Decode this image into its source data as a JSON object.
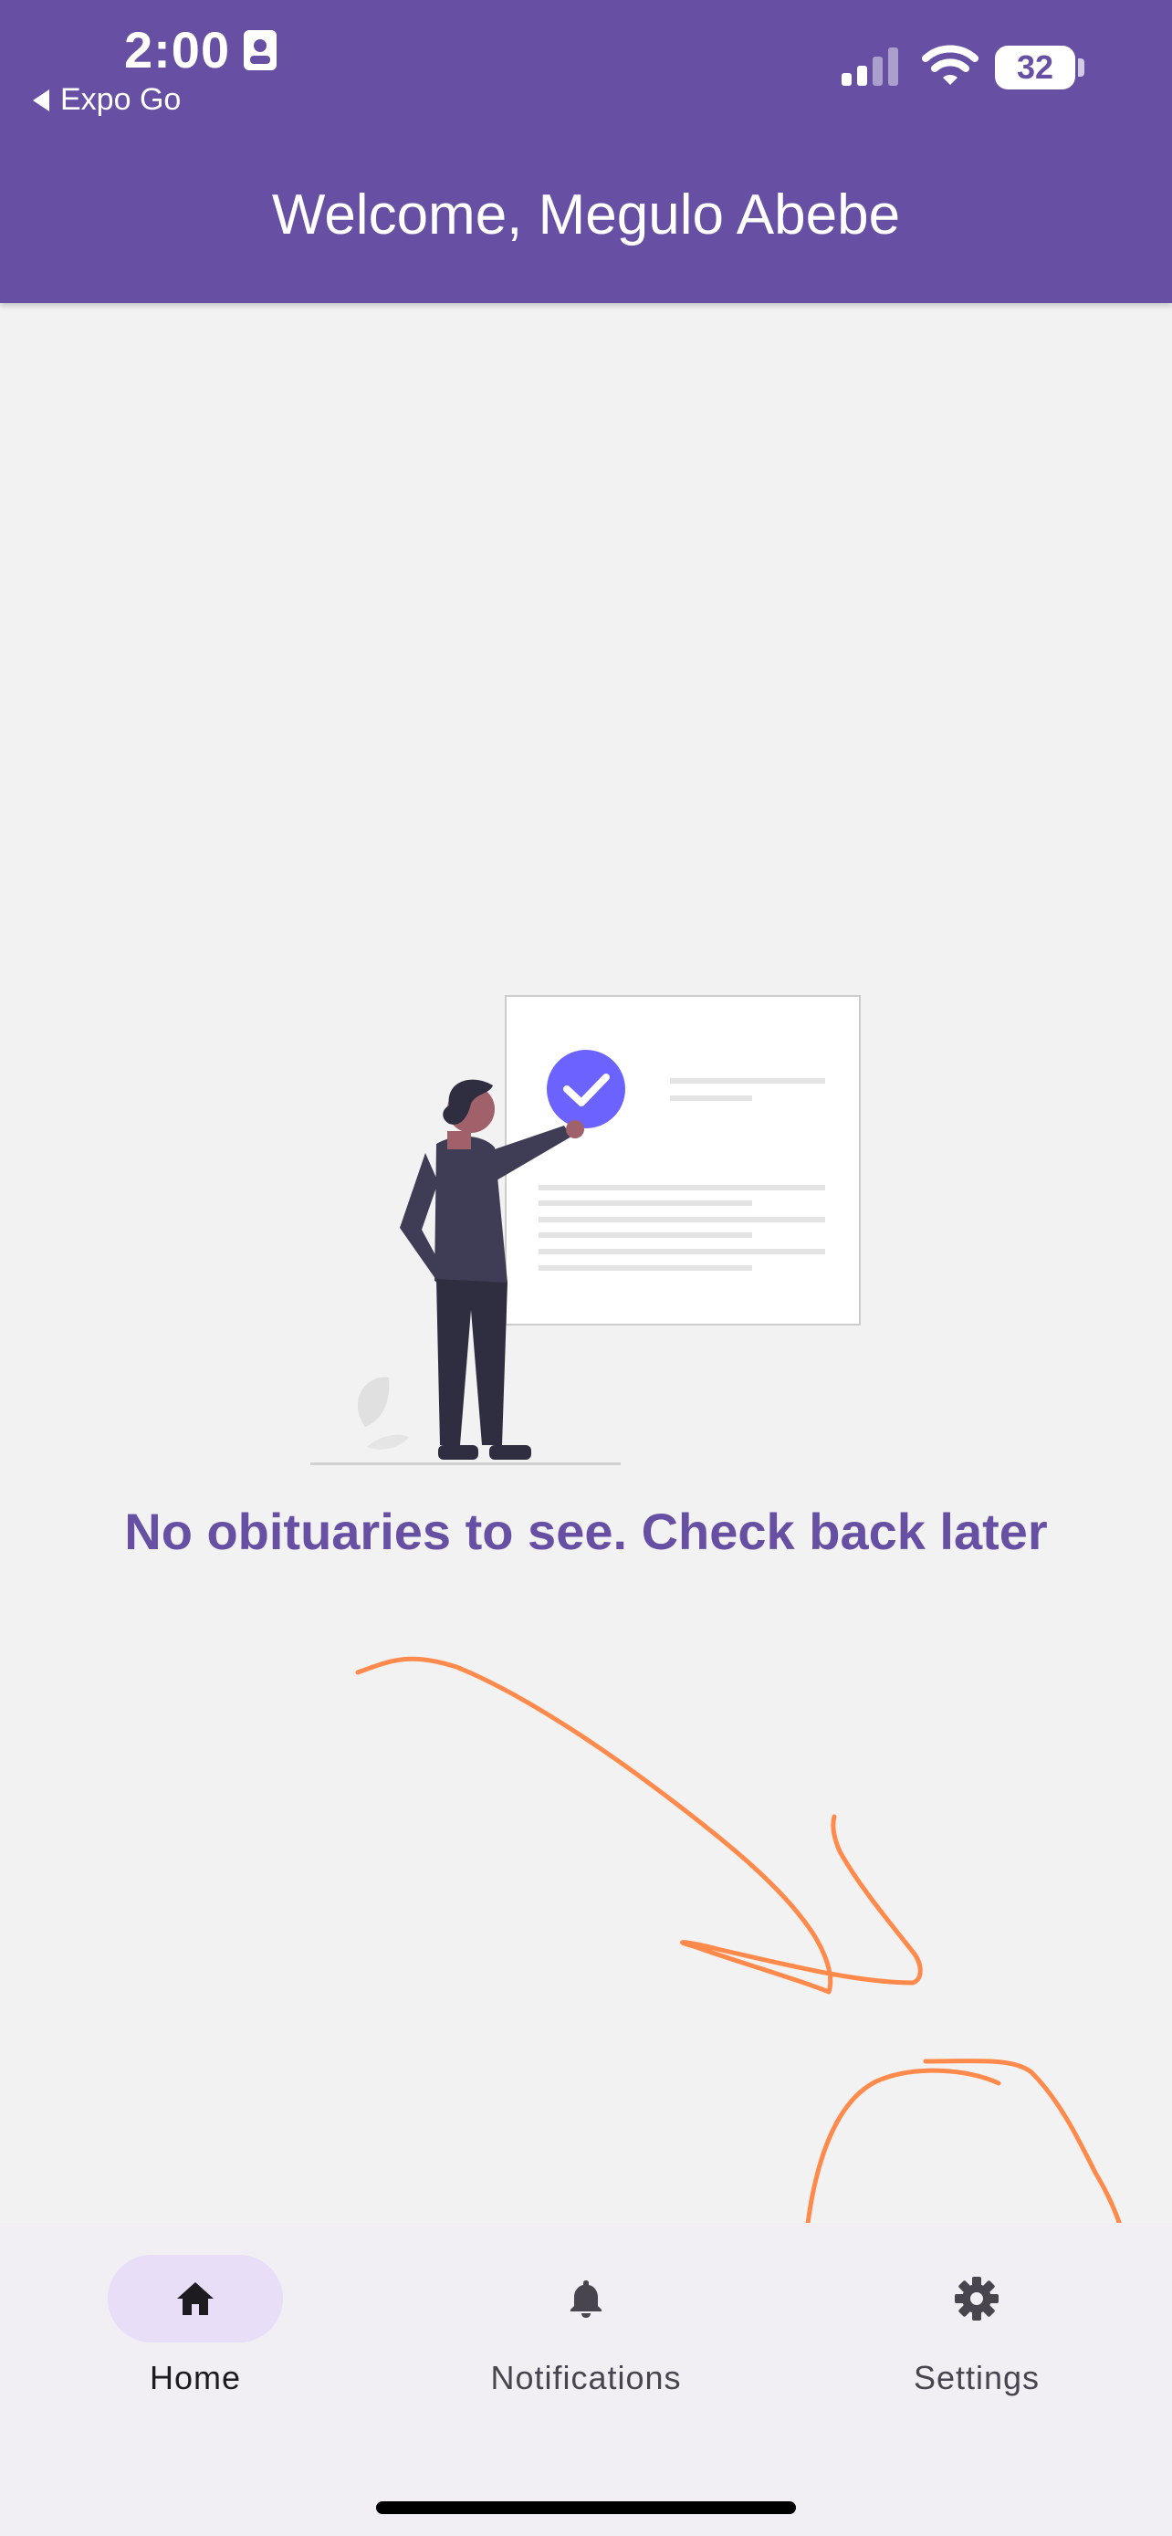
{
  "status_bar": {
    "time": "2:00",
    "back_label": "Expo Go",
    "battery": "32"
  },
  "header": {
    "title": "Welcome, Megulo Abebe"
  },
  "empty_state": {
    "message": "No obituaries to see. Check back later"
  },
  "nav": {
    "items": [
      {
        "label": "Home",
        "icon": "home-icon",
        "active": true
      },
      {
        "label": "Notifications",
        "icon": "bell-icon",
        "active": false
      },
      {
        "label": "Settings",
        "icon": "gear-icon",
        "active": false
      }
    ]
  },
  "colors": {
    "primary": "#6750a4",
    "accent": "#6c63ff",
    "annotation": "#ff8a4c",
    "background": "#f2f2f2"
  }
}
